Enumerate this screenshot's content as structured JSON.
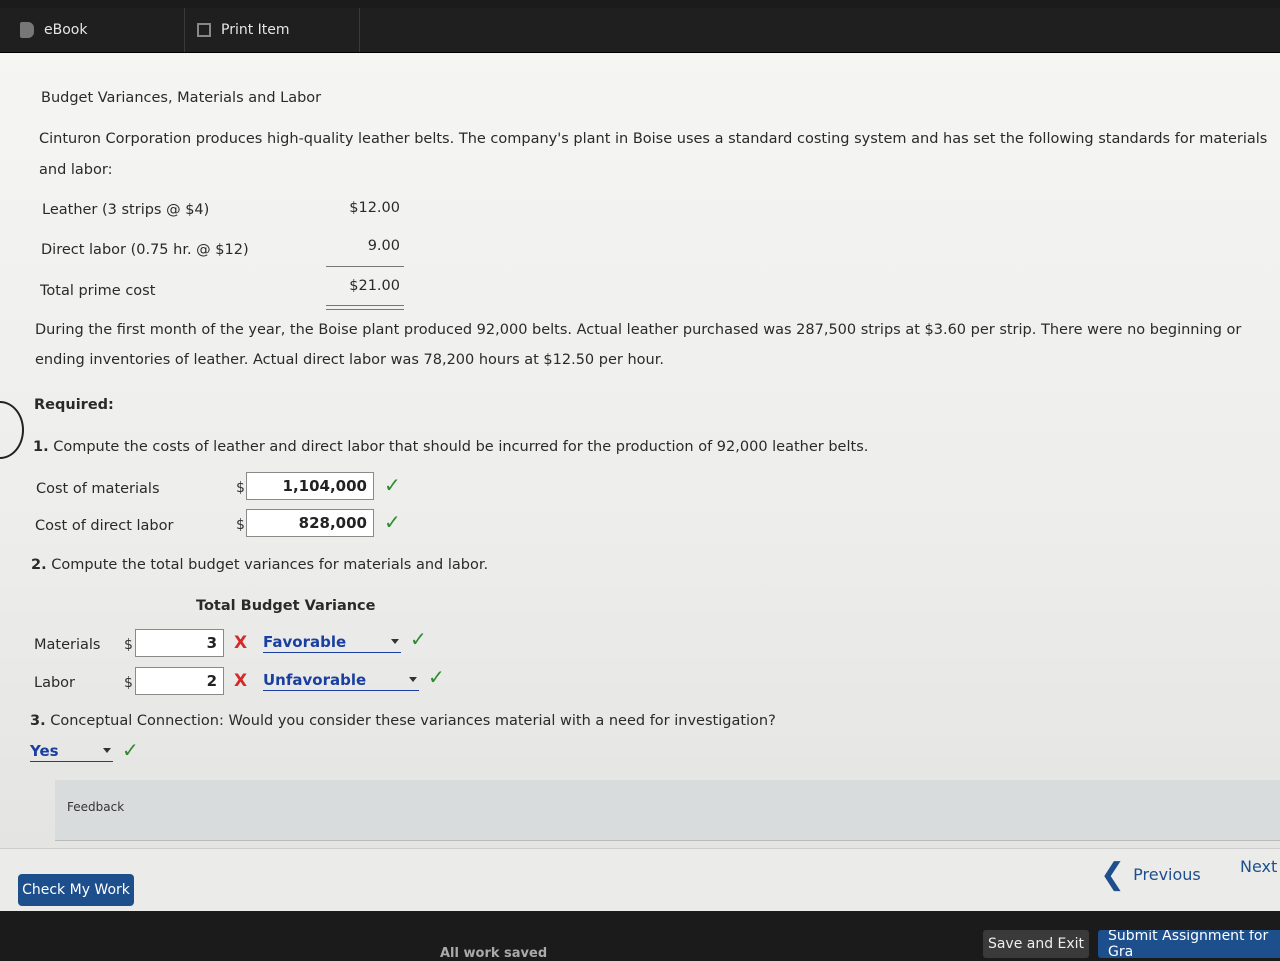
{
  "toolbar": {
    "ebook_label": "eBook",
    "print_label": "Print Item"
  },
  "problem": {
    "title": "Budget Variances, Materials and Labor",
    "intro_line1": "Cinturon Corporation produces high-quality leather belts. The company's plant in Boise uses a standard costing system and has set the following standards for materials",
    "intro_line2": "and labor:",
    "standards": [
      {
        "label": "Leather (3 strips @ $4)",
        "amount": "$12.00"
      },
      {
        "label": "Direct labor (0.75 hr. @ $12)",
        "amount": "9.00"
      },
      {
        "label": "Total prime cost",
        "amount": "$21.00"
      }
    ],
    "details_line1": "During the first month of the year, the Boise plant produced 92,000 belts. Actual leather purchased was 287,500 strips at $3.60 per strip. There were no beginning or",
    "details_line2": "ending inventories of leather. Actual direct labor was 78,200 hours at $12.50 per hour.",
    "required_label": "Required:"
  },
  "q1": {
    "number": "1.",
    "text": "Compute the costs of leather and direct labor that should be incurred for the production of 92,000 leather belts.",
    "rows": [
      {
        "label": "Cost of materials",
        "currency": "$",
        "value": "1,104,000"
      },
      {
        "label": "Cost of direct labor",
        "currency": "$",
        "value": "828,000"
      }
    ],
    "check": "✓"
  },
  "q2": {
    "number": "2.",
    "text": "Compute the total budget variances for materials and labor.",
    "header": "Total Budget Variance",
    "rows": [
      {
        "label": "Materials",
        "currency": "$",
        "value": "3",
        "mark": "X",
        "selection": "Favorable"
      },
      {
        "label": "Labor",
        "currency": "$",
        "value": "2",
        "mark": "X",
        "selection": "Unfavorable"
      }
    ]
  },
  "q3": {
    "number": "3.",
    "text": "Conceptual Connection: Would you consider these variances material with a need for investigation?",
    "selection": "Yes"
  },
  "feedback_label": "Feedback",
  "nav": {
    "check_my_work": "Check My Work",
    "previous": "Previous",
    "previous_chevron": "❮",
    "next": "Next"
  },
  "footer": {
    "status": "All work saved",
    "save_exit": "Save and Exit",
    "submit": "Submit Assignment for Gra"
  },
  "colors": {
    "accent": "#1d4f8c",
    "correct": "#2e8b2e",
    "incorrect": "#d62a2a"
  }
}
